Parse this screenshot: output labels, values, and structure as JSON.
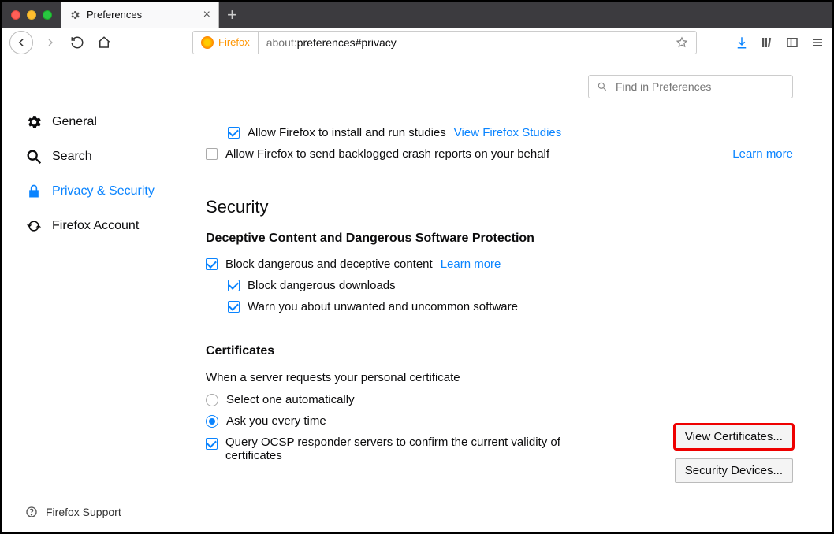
{
  "tab": {
    "title": "Preferences"
  },
  "urlbar": {
    "brand": "Firefox",
    "address_prefix": "about:",
    "address_rest": "preferences#privacy"
  },
  "search": {
    "placeholder": "Find in Preferences"
  },
  "sidebar": {
    "items": [
      {
        "label": "General"
      },
      {
        "label": "Search"
      },
      {
        "label": "Privacy & Security"
      },
      {
        "label": "Firefox Account"
      }
    ],
    "help": "Firefox Support"
  },
  "studies": {
    "allow": "Allow Firefox to install and run studies",
    "view_link": "View Firefox Studies",
    "crash": "Allow Firefox to send backlogged crash reports on your behalf",
    "learn": "Learn more"
  },
  "security": {
    "heading": "Security",
    "deceptive_heading": "Deceptive Content and Dangerous Software Protection",
    "block": "Block dangerous and deceptive content",
    "block_learn": "Learn more",
    "downloads": "Block dangerous downloads",
    "warn": "Warn you about unwanted and uncommon software"
  },
  "certs": {
    "heading": "Certificates",
    "request": "When a server requests your personal certificate",
    "auto": "Select one automatically",
    "ask": "Ask you every time",
    "ocsp": "Query OCSP responder servers to confirm the current validity of certificates",
    "view_btn": "View Certificates...",
    "devices_btn": "Security Devices..."
  }
}
